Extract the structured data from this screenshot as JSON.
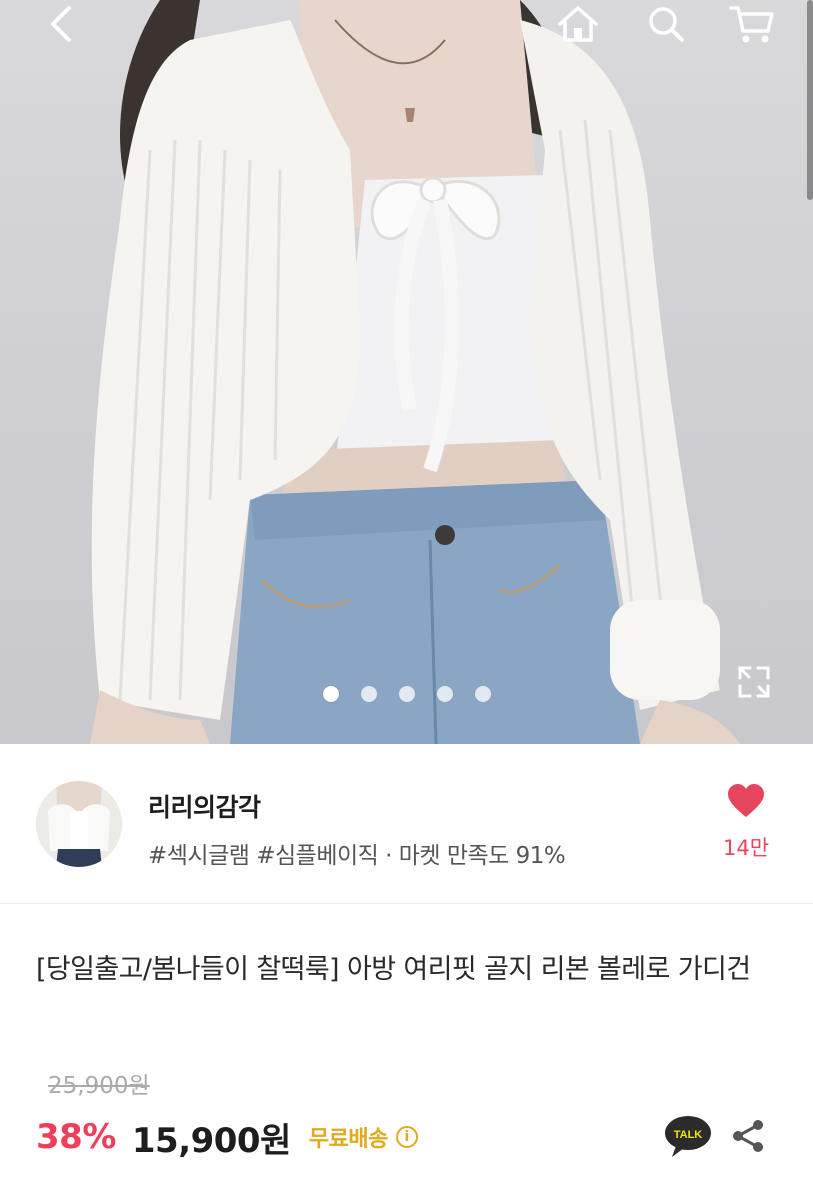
{
  "header": {
    "back_icon": "chevron-left-icon",
    "home_icon": "home-icon",
    "search_icon": "search-icon",
    "cart_icon": "cart-icon"
  },
  "gallery": {
    "image_count": 5,
    "active_index": 0,
    "expand_icon": "expand-icon"
  },
  "store": {
    "name": "리리의감각",
    "meta": "#섹시글램 #심플베이직 · 마켓 만족도 91%",
    "like_icon": "heart-icon",
    "like_count": "14만",
    "like_color": "#e6455e"
  },
  "product": {
    "title": "[당일출고/봄나들이 찰떡룩] 아방 여리핏 골지 리본 볼레로 가디건",
    "original_price": "25,900원",
    "discount": "38%",
    "price": "15,900원",
    "shipping": "무료배송",
    "info_icon": "info-icon",
    "info_glyph": "i",
    "talk_label": "TALK",
    "talk_icon": "kakao-talk-icon",
    "share_icon": "share-icon"
  },
  "colors": {
    "discount": "#f03e5a",
    "shipping": "#e1a91c",
    "talk_bubble": "#2b2b2b"
  }
}
